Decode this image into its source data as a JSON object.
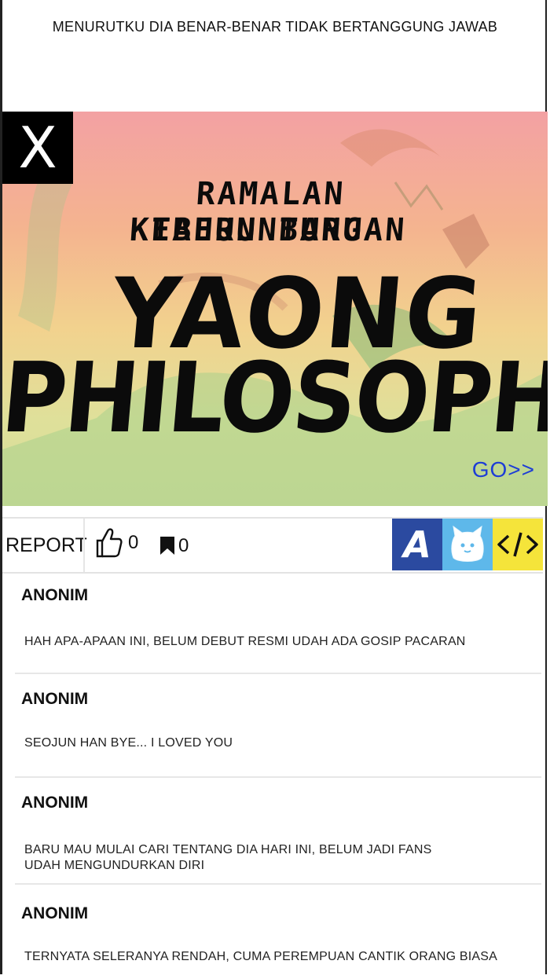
{
  "top_comment": {
    "text": "MENURUTKU DIA BENAR-BENAR TIDAK BERTANGGUNG JAWAB"
  },
  "banner": {
    "close_label": "X",
    "subtitle_line1": "RAMALAN KEBERUNTUNGAN",
    "subtitle_line2": "TAHUN BARU",
    "title_line1": "YAONG",
    "title_line2": "PHILOSOPHY",
    "go_label": "GO>>"
  },
  "toolbar": {
    "report_label": "REPORT",
    "like_count": "0",
    "bookmark_count": "0",
    "icons": [
      "thumbs-up-icon",
      "bookmark-icon",
      "letter-a-icon",
      "cat-icon",
      "code-icon"
    ],
    "colors": {
      "a_bg": "#2b4aa0",
      "cat_bg": "#5eb8ea",
      "code_bg": "#f5e43a"
    }
  },
  "comments": [
    {
      "author": "ANONIM",
      "text": "HAH APA-APAAN INI, BELUM DEBUT RESMI UDAH ADA GOSIP PACARAN"
    },
    {
      "author": "ANONIM",
      "text": "SEOJUN HAN BYE... I LOVED YOU"
    },
    {
      "author": "ANONIM",
      "text": "BARU MAU MULAI CARI TENTANG DIA HARI INI, BELUM JADI FANS\nUDAH MENGUNDURKAN DIRI"
    },
    {
      "author": "ANONIM",
      "text": "TERNYATA SELERANYA RENDAH, CUMA PEREMPUAN CANTIK ORANG BIASA"
    }
  ]
}
